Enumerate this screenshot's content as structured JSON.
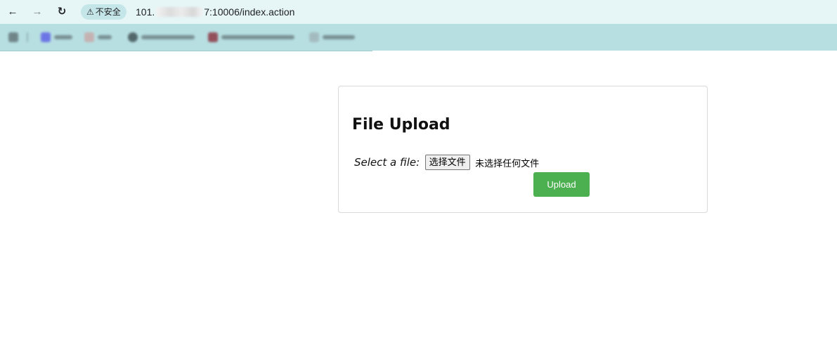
{
  "browser": {
    "security_label": "不安全",
    "url_prefix": "101.",
    "url_suffix": "7:10006/index.action"
  },
  "page": {
    "title": "File Upload",
    "file_label": "Select a file:",
    "choose_button": "选择文件",
    "no_file_text": "未选择任何文件",
    "upload_button": "Upload"
  },
  "colors": {
    "address_bar": "#e6f6f7",
    "bookmarks_bar": "#b7dfe2",
    "upload_button": "#4caf50"
  }
}
